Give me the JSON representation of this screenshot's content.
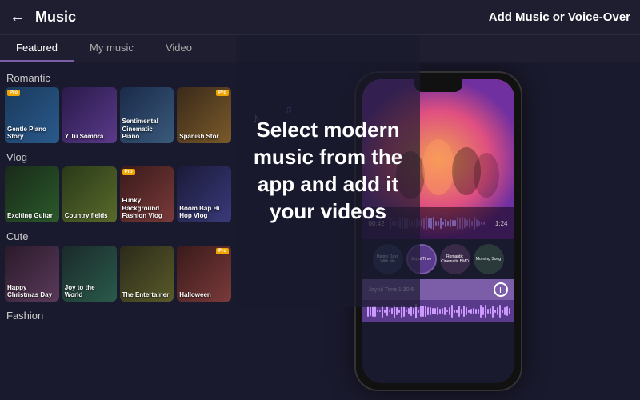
{
  "header": {
    "title": "Music",
    "right_text": "Add Music or Voice-Over",
    "back_label": "←"
  },
  "tabs": [
    {
      "label": "Featured",
      "active": true
    },
    {
      "label": "My music",
      "active": false
    },
    {
      "label": "Video",
      "active": false
    }
  ],
  "sections": [
    {
      "title": "Romantic",
      "cards": [
        {
          "label": "Gentle Piano Story",
          "pro": true,
          "color": "card-romantic1"
        },
        {
          "label": "Y Tu Sombra",
          "pro": false,
          "color": "card-romantic2"
        },
        {
          "label": "Sentimental Cinematic Piano",
          "pro": false,
          "color": "card-romantic3"
        },
        {
          "label": "Spanish Stor",
          "pro": true,
          "color": "card-romantic4"
        }
      ]
    },
    {
      "title": "Vlog",
      "cards": [
        {
          "label": "Exciting Guitar",
          "pro": false,
          "color": "card-vlog1"
        },
        {
          "label": "Country fields",
          "pro": false,
          "color": "card-vlog2"
        },
        {
          "label": "Funky Background Fashion Vlog",
          "pro": true,
          "color": "card-vlog3"
        },
        {
          "label": "Boom Bap Hi Hop Vlog",
          "pro": false,
          "color": "card-vlog4"
        }
      ]
    },
    {
      "title": "Cute",
      "cards": [
        {
          "label": "Happy Christmas Day",
          "pro": false,
          "color": "card-cute1"
        },
        {
          "label": "Joy to the World",
          "pro": false,
          "color": "card-cute2"
        },
        {
          "label": "The Entertainer",
          "pro": false,
          "color": "card-cute3"
        },
        {
          "label": "Halloween",
          "pro": true,
          "color": "card-cute4"
        }
      ]
    },
    {
      "title": "Fashion",
      "cards": []
    }
  ],
  "overlay": {
    "text": "Select modern music from the app and add it your videos"
  },
  "phone": {
    "time_start": "00:42",
    "time_end": "1:24",
    "thumbnails": [
      {
        "label": "Happy Days With Me",
        "active": false,
        "bg": "#2a3a5a"
      },
      {
        "label": "Joyful Time",
        "active": true,
        "bg": "#5a3a8a"
      },
      {
        "label": "Romantic Cinematic BMD",
        "active": false,
        "bg": "#3a2a4a"
      },
      {
        "label": "Morning Song",
        "active": false,
        "bg": "#2a3a3a"
      }
    ],
    "bottom_label": "Joyful Time  1:30.6",
    "add_label": "+"
  }
}
